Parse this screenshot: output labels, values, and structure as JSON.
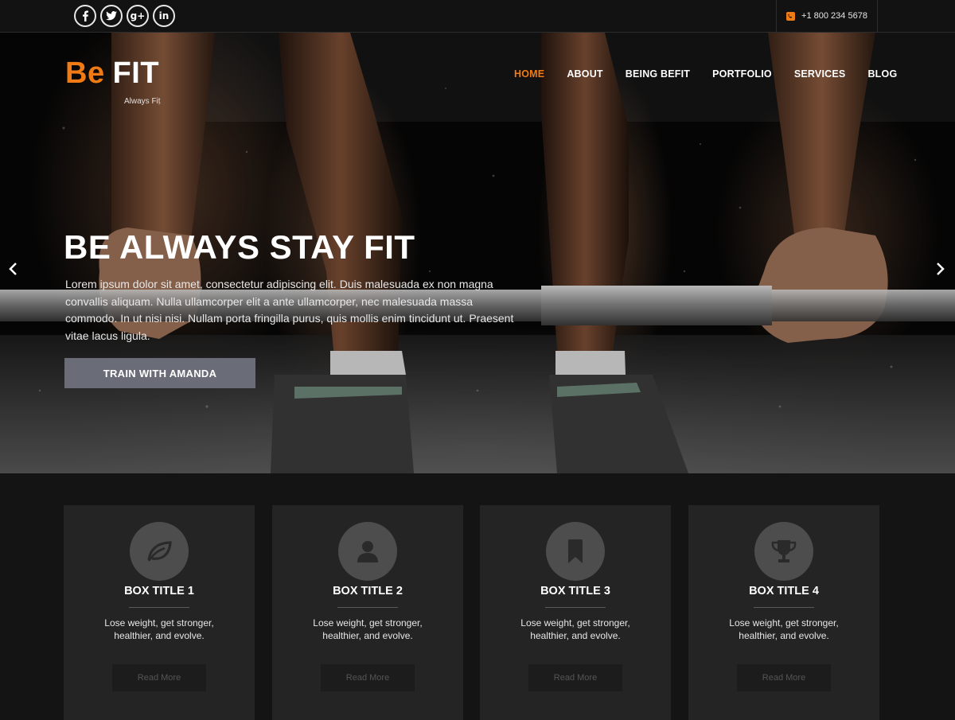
{
  "topbar": {
    "social": [
      {
        "name": "facebook-icon",
        "glyph": "f"
      },
      {
        "name": "twitter-icon",
        "glyph": ""
      },
      {
        "name": "google-plus-icon",
        "glyph": "g+"
      },
      {
        "name": "linkedin-icon",
        "glyph": "in"
      }
    ],
    "phone": "+1 800 234 5678"
  },
  "header": {
    "logo_be": "Be",
    "logo_fit": "FIT",
    "tagline": "Always Fit",
    "nav": [
      "HOME",
      "ABOUT",
      "BEING BEFIT",
      "PORTFOLIO",
      "SERVICES",
      "BLOG"
    ],
    "active_nav": "HOME"
  },
  "hero": {
    "title": "BE ALWAYS STAY FIT",
    "text": "Lorem ipsum dolor sit amet, consectetur adipiscing elit. Duis malesuada ex non magna convallis aliquam. Nulla ullamcorper elit a ante ullamcorper, nec malesuada massa commodo. In ut nisi nisi. Nullam porta fringilla purus, quis mollis enim tincidunt ut. Praesent vitae lacus ligula.",
    "button": "TRAIN WITH AMANDA"
  },
  "boxes": [
    {
      "title": "BOX TITLE 1",
      "icon": "leaf-icon",
      "desc": "Lose weight, get stronger, healthier, and evolve.",
      "button": "Read More"
    },
    {
      "title": "BOX TITLE 2",
      "icon": "user-icon",
      "desc": "Lose weight, get stronger, healthier, and evolve.",
      "button": "Read More"
    },
    {
      "title": "BOX TITLE 3",
      "icon": "bookmark-icon",
      "desc": "Lose weight, get stronger, healthier, and evolve.",
      "button": "Read More"
    },
    {
      "title": "BOX TITLE 4",
      "icon": "trophy-icon",
      "desc": "Lose weight, get stronger, healthier, and evolve.",
      "button": "Read More"
    }
  ],
  "colors": {
    "accent": "#f07b14",
    "button": "#6a6d78",
    "box_bg": "#242424",
    "page_bg": "#141414"
  }
}
